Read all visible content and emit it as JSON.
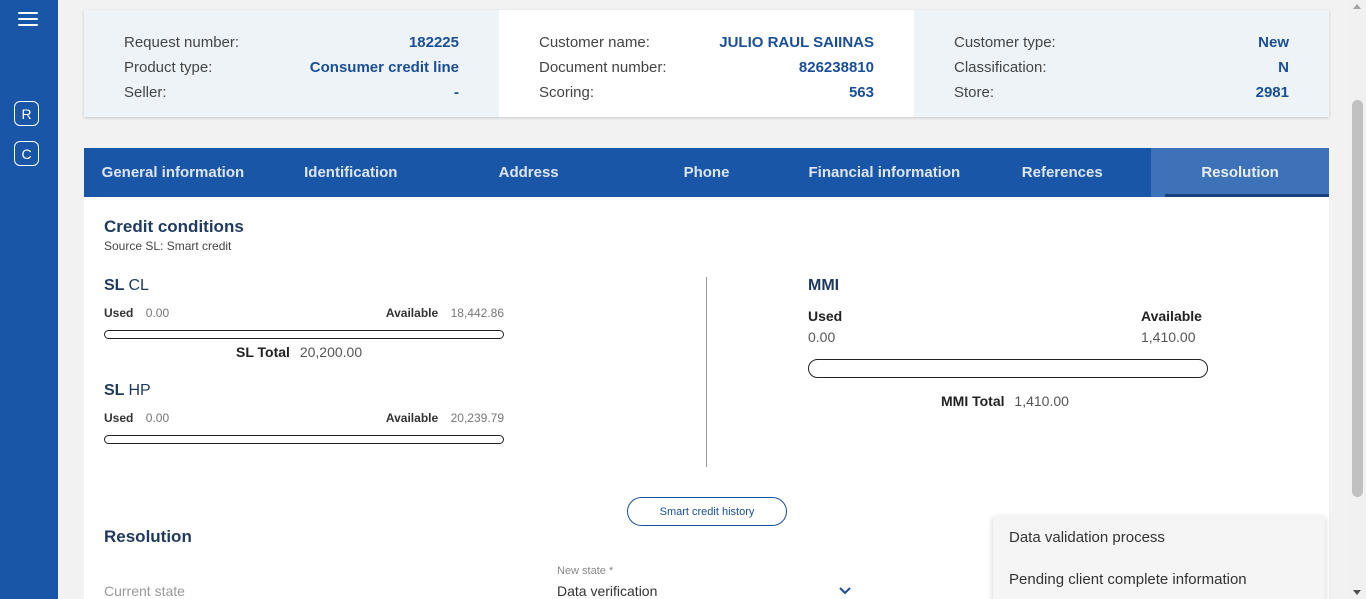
{
  "sidebar": {
    "badges": [
      "R",
      "C"
    ]
  },
  "summary": {
    "col1": [
      {
        "label": "Request number:",
        "value": "182225"
      },
      {
        "label": "Product type:",
        "value": "Consumer credit line"
      },
      {
        "label": "Seller:",
        "value": "-"
      }
    ],
    "col2": [
      {
        "label": "Customer name:",
        "value": "JULIO RAUL SAIINAS"
      },
      {
        "label": "Document number:",
        "value": "826238810"
      },
      {
        "label": "Scoring:",
        "value": "563"
      }
    ],
    "col3": [
      {
        "label": "Customer type:",
        "value": "New"
      },
      {
        "label": "Classification:",
        "value": "N"
      },
      {
        "label": "Store:",
        "value": "2981"
      }
    ]
  },
  "tabs": [
    "General information",
    "Identification",
    "Address",
    "Phone",
    "Financial information",
    "References",
    "Resolution"
  ],
  "active_tab": "Resolution",
  "credit": {
    "title": "Credit conditions",
    "source": "Source SL: Smart credit",
    "sl_cl": {
      "prefix": "SL",
      "suffix": "CL",
      "used_label": "Used",
      "used": "0.00",
      "available_label": "Available",
      "available": "18,442.86",
      "total_label": "SL Total",
      "total": "20,200.00",
      "used_fraction": 0
    },
    "sl_hp": {
      "prefix": "SL",
      "suffix": "HP",
      "used_label": "Used",
      "used": "0.00",
      "available_label": "Available",
      "available": "20,239.79",
      "used_fraction": 0
    },
    "mmi": {
      "title": "MMI",
      "used_label": "Used",
      "used": "0.00",
      "available_label": "Available",
      "available": "1,410.00",
      "total_label": "MMI Total",
      "total": "1,410.00",
      "used_fraction": 0
    },
    "history_button": "Smart credit history"
  },
  "resolution": {
    "title": "Resolution",
    "current_state_label": "Current state",
    "new_state_label": "New state *",
    "new_state_value": "Data verification"
  },
  "dropdown": {
    "options": [
      "Data validation process",
      "Pending client complete information"
    ]
  }
}
